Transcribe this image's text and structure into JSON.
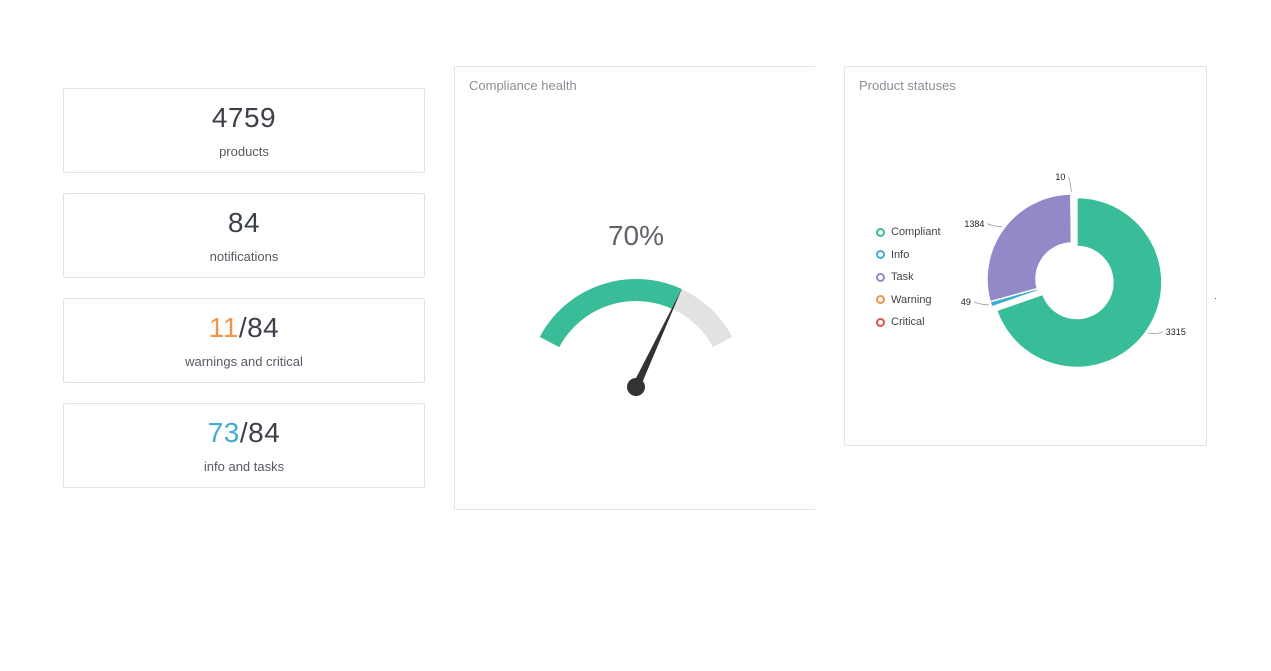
{
  "stats": {
    "products": {
      "value": "4759",
      "label": "products"
    },
    "notifications": {
      "value": "84",
      "label": "notifications"
    },
    "warnings": {
      "highlight": "11",
      "rest": "/84",
      "label": "warnings and critical",
      "color": "#ef9448"
    },
    "info": {
      "highlight": "73",
      "rest": "/84",
      "label": "info and tasks",
      "color": "#3eaed0"
    }
  },
  "compliance": {
    "title": "Compliance health",
    "value_text": "70%",
    "percent": 70,
    "fill_color": "#38bd98",
    "track_color": "#e2e2e2",
    "needle_color": "#333333"
  },
  "product_statuses": {
    "title": "Product statuses",
    "legend": [
      {
        "label": "Compliant",
        "color": "#38bd98"
      },
      {
        "label": "Info",
        "color": "#3eaed0"
      },
      {
        "label": "Task",
        "color": "#9289c9"
      },
      {
        "label": "Warning",
        "color": "#ef9448"
      },
      {
        "label": "Critical",
        "color": "#e0544d"
      }
    ],
    "chart_data": {
      "type": "pie",
      "categories": [
        "Compliant",
        "Info",
        "Task",
        "Warning",
        "Critical"
      ],
      "values": [
        3315,
        49,
        1384,
        0,
        10
      ],
      "labels": [
        "3315",
        "49",
        "1384",
        "",
        "10"
      ],
      "colors": [
        "#38bd98",
        "#3eaed0",
        "#9289c9",
        "#ef9448",
        "#e0544d"
      ],
      "legend_position": "left"
    }
  }
}
